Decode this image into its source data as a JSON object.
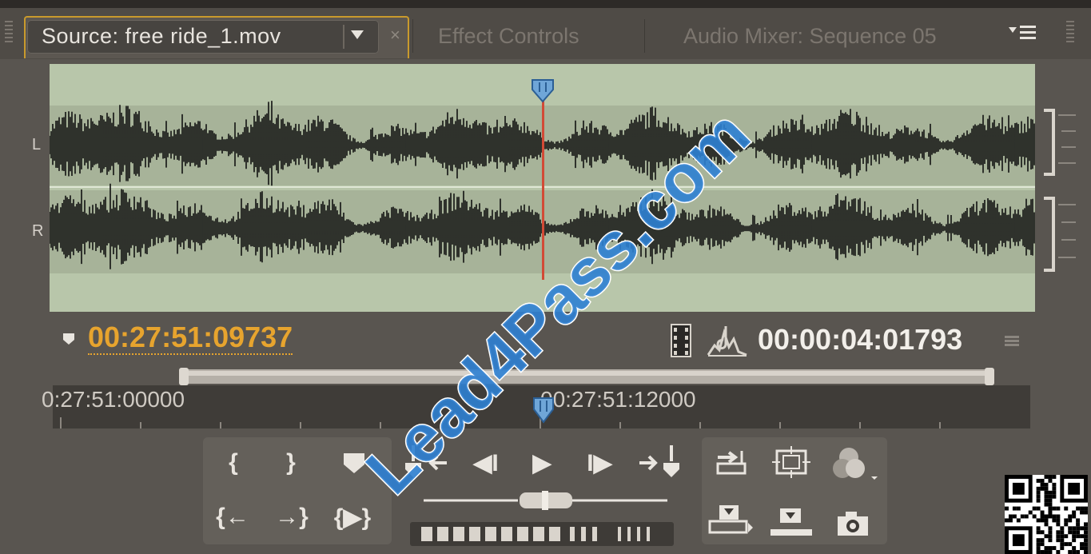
{
  "tabs": {
    "source_title": "Source: free ride_1.mov",
    "close_symbol": "×",
    "effect_controls": "Effect Controls",
    "audio_mixer": "Audio Mixer: Sequence 05"
  },
  "waveform": {
    "channel_left": "L",
    "channel_right": "R",
    "playhead_fraction": 0.5
  },
  "timecode": {
    "current": "00:27:51:09737",
    "duration": "00:00:04:01793"
  },
  "ruler": {
    "label_start": "0:27:51:00000",
    "label_mid": "00:27:51:12000"
  },
  "controls": {
    "mark_in": "{",
    "mark_out": "}",
    "go_to_in": "{←",
    "go_to_out": "→}",
    "play_in_to_out": "{▶}",
    "step_back": "◀I",
    "play": "▶",
    "step_forward": "I▶"
  },
  "watermark": "Lead4Pass.com",
  "colors": {
    "accent_timecode": "#e7a42e",
    "playhead": "#d24a36",
    "waveform_bg": "#b8c6aa",
    "watermark": "#2d7fd1"
  }
}
